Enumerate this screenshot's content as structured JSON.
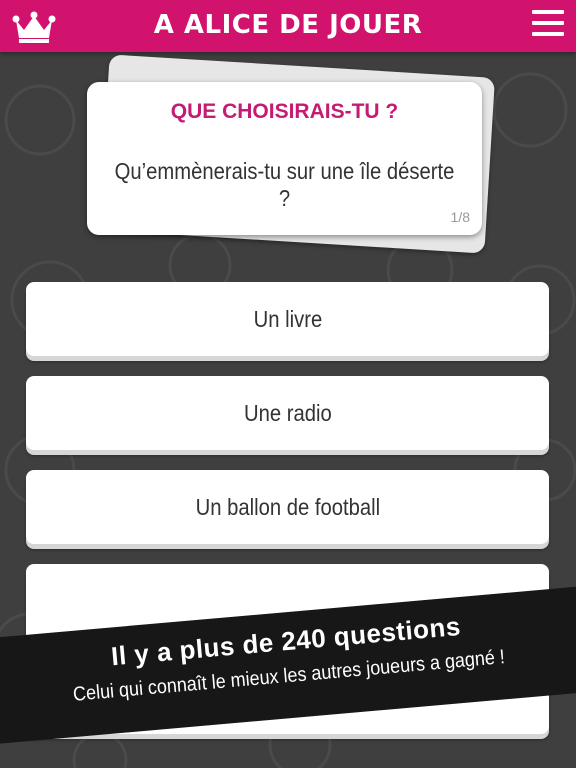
{
  "header": {
    "title": "A ALICE DE JOUER",
    "crown_icon": "crown-icon",
    "menu_icon": "hamburger-menu-icon",
    "bar_color": "#d1136e"
  },
  "card": {
    "heading": "QUE CHOISIRAIS-TU ?",
    "question": "Qu’emmènerais-tu sur une île déserte ?",
    "counter": "1/8",
    "heading_color": "#c41b73"
  },
  "answers": [
    {
      "label": "Un livre"
    },
    {
      "label": "Une radio"
    },
    {
      "label": "Un ballon de football"
    },
    {
      "label": ""
    }
  ],
  "banner": {
    "title": "Il y a plus de 240 questions",
    "subtitle": "Celui qui connaît le mieux les autres joueurs a gagné !"
  },
  "background_color": "#3f3f3f"
}
